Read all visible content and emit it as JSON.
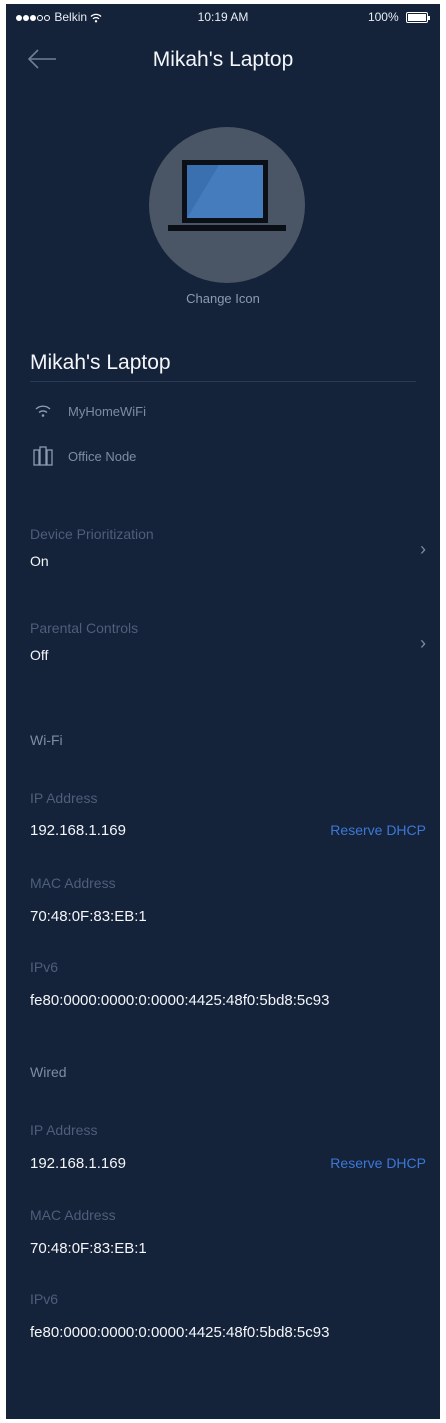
{
  "status_bar": {
    "carrier": "Belkin",
    "time": "10:19 AM",
    "battery": "100%"
  },
  "header": {
    "title": "Mikah's Laptop",
    "back_icon": "arrow-left-icon"
  },
  "device": {
    "icon": "laptop-icon",
    "change_icon_label": "Change Icon",
    "name": "Mikah's Laptop",
    "network": "MyHomeWiFi",
    "network_icon": "wifi-icon",
    "node": "Office Node",
    "node_icon": "node-icon"
  },
  "settings": {
    "prioritization": {
      "label": "Device Prioritization",
      "value": "On"
    },
    "parental": {
      "label": "Parental Controls",
      "value": "Off"
    }
  },
  "wifi": {
    "heading": "Wi-Fi",
    "ip_label": "IP Address",
    "ip": "192.168.1.169",
    "reserve_label": "Reserve DHCP",
    "mac_label": "MAC Address",
    "mac": "70:48:0F:83:EB:1",
    "ipv6_label": "IPv6",
    "ipv6": "fe80:0000:0000:0:0000:4425:48f0:5bd8:5c93"
  },
  "wired": {
    "heading": "Wired",
    "ip_label": "IP Address",
    "ip": "192.168.1.169",
    "reserve_label": "Reserve DHCP",
    "mac_label": "MAC Address",
    "mac": "70:48:0F:83:EB:1",
    "ipv6_label": "IPv6",
    "ipv6": "fe80:0000:0000:0:0000:4425:48f0:5bd8:5c93"
  },
  "colors": {
    "background": "#14223a",
    "link": "#3d78d6",
    "muted_label": "#4f5f79"
  }
}
